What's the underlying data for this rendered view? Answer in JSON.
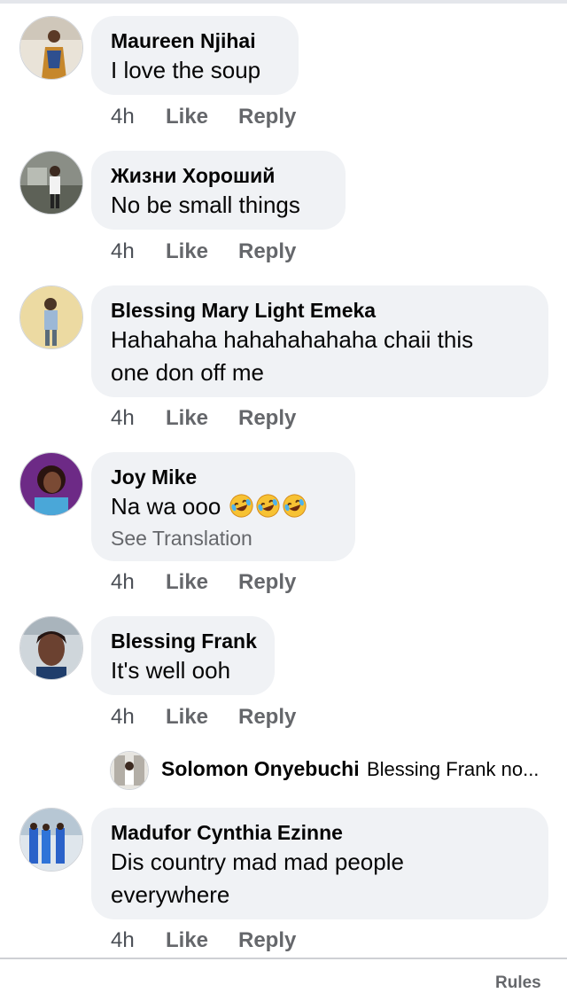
{
  "comments": [
    {
      "name": "Maureen Njihai",
      "lines": [
        "I love the soup"
      ],
      "time": "4h",
      "like": "Like",
      "reply": "Reply"
    },
    {
      "name": "Жизни Хороший",
      "lines": [
        "No be small things"
      ],
      "time": "4h",
      "like": "Like",
      "reply": "Reply"
    },
    {
      "name": "Blessing Mary Light Emeka",
      "lines": [
        "Hahahaha hahahahahaha chaii this",
        "one don off me"
      ],
      "time": "4h",
      "like": "Like",
      "reply": "Reply"
    },
    {
      "name": "Joy Mike",
      "lines": [
        "Na wa ooo"
      ],
      "emoji": "rolling-on-floor-laughing",
      "translate": "See Translation",
      "time": "4h",
      "like": "Like",
      "reply": "Reply"
    },
    {
      "name": "Blessing Frank",
      "lines": [
        "It's well ooh"
      ],
      "time": "4h",
      "like": "Like",
      "reply": "Reply"
    },
    {
      "name": "Madufor Cynthia Ezinne",
      "lines": [
        "Dis country mad mad people",
        "everywhere"
      ],
      "time": "4h",
      "like": "Like",
      "reply": "Reply"
    }
  ],
  "reply_preview": {
    "name": "Solomon Onyebuchi",
    "text": "Blessing Frank no..."
  },
  "footer": {
    "rules": "Rules"
  },
  "colors": {
    "bubble": "#f0f2f5",
    "secondary_text": "#65676b",
    "primary_text": "#050505"
  }
}
